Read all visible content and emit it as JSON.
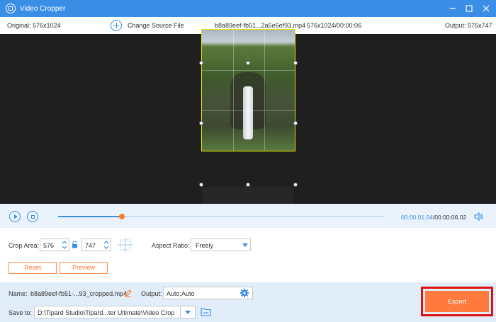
{
  "window": {
    "title": "Video Cropper",
    "icon": "crop-app-icon"
  },
  "info": {
    "original": "Original: 576x1024",
    "change_source": "Change Source File",
    "file_name": "b8a89eef-fb51...2a5e6ef93.mp4",
    "resolution_duration": "576x1024/00:00:06",
    "output": "Output: 576x747"
  },
  "player": {
    "time_current": "00:00:01.04",
    "time_total": "/00:00:06.02",
    "progress": 0.195,
    "accent": "#3b8ee6",
    "knob_color": "#ff7a2a"
  },
  "crop": {
    "area_label": "Crop Area:",
    "width": "576",
    "height": "747",
    "aspect_label": "Aspect Ratio:",
    "aspect_value": "Freely",
    "reset_label": "Reset",
    "preview_label": "Preview"
  },
  "output": {
    "name_label": "Name:",
    "name_value": "b8a89eef-fb51-...93_cropped.mp4",
    "output_label": "Output:",
    "output_value": "Auto;Auto",
    "save_label": "Save to:",
    "save_path": "D:\\Tipard Studio\\Tipard...ter Ultimate\\Video Crop",
    "export_label": "Export",
    "export_color": "#ff7a3d",
    "highlight_color": "#e01010"
  }
}
